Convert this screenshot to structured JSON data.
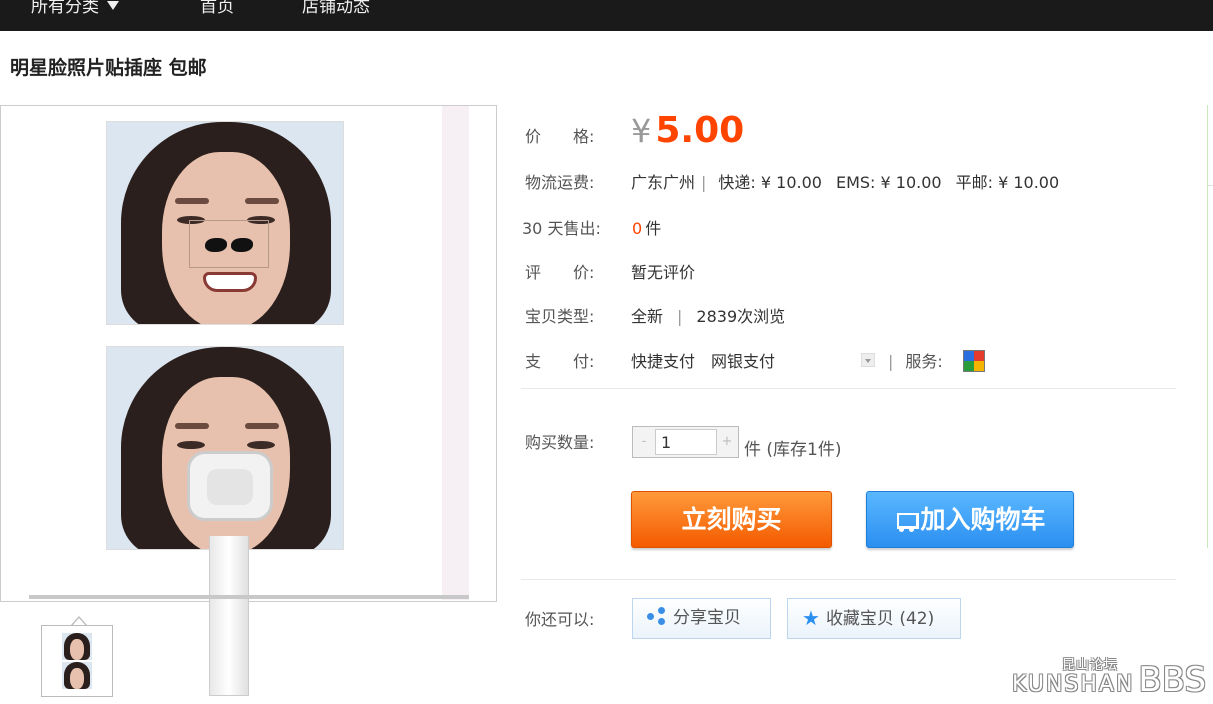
{
  "topnav": {
    "items": [
      {
        "label": "所有分类"
      },
      {
        "label": "首页"
      },
      {
        "label": "店铺动态"
      }
    ]
  },
  "product": {
    "title": "明星脸照片贴插座 包邮",
    "price": {
      "label": "价　　格:",
      "currency": "¥",
      "value": "5.00"
    },
    "shipping": {
      "label": "物流运费:",
      "origin": "广东广州",
      "express": "快递: ¥ 10.00",
      "ems": "EMS: ¥ 10.00",
      "mail": "平邮: ¥ 10.00"
    },
    "sold": {
      "label": "30 天售出:",
      "count": "0",
      "unit": "件"
    },
    "rating": {
      "label": "评　　价:",
      "value": "暂无评价"
    },
    "type": {
      "label": "宝贝类型:",
      "value": "全新",
      "views": "2839次浏览"
    },
    "payment": {
      "label": "支　　付:",
      "method1": "快捷支付",
      "method2": "网银支付",
      "service_label": "服务:"
    },
    "quantity": {
      "label": "购买数量:",
      "value": "1",
      "stock": "件 (库存1件)",
      "minus": "-",
      "plus": "+"
    },
    "buttons": {
      "buy": "立刻购买",
      "cart": "加入购物车"
    },
    "more": {
      "label": "你还可以:",
      "share": "分享宝贝",
      "favorite": "收藏宝贝 (42)"
    }
  },
  "watermark": {
    "small": "昆山论坛",
    "text": "KUNSHAN",
    "big": "BBS"
  },
  "colors": {
    "price": "#ff4400",
    "buy_button": "#f45a00",
    "cart_button": "#2b8ff0",
    "nav_bg": "#1a1a1a"
  },
  "icons": [
    "caret-down-icon",
    "cart-icon",
    "share-icon",
    "star-icon",
    "service-icon",
    "dropdown-icon"
  ]
}
